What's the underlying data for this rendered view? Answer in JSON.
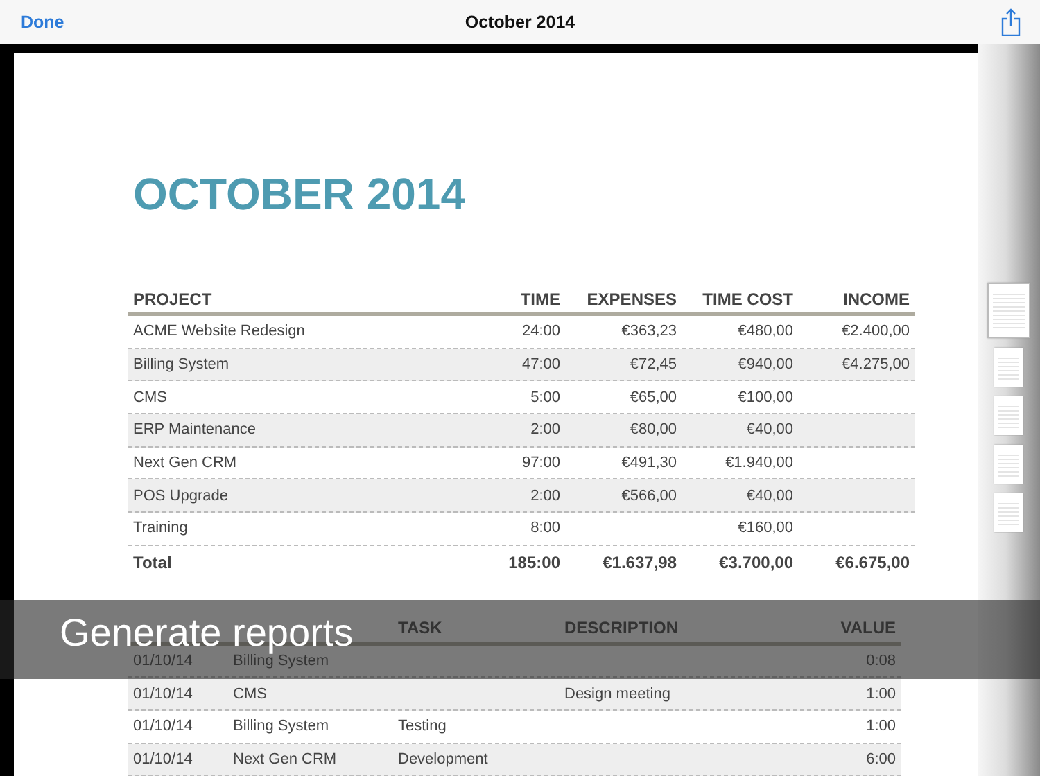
{
  "navbar": {
    "done": "Done",
    "title": "October 2014"
  },
  "report": {
    "title": "OCTOBER 2014",
    "summary": {
      "columns": [
        "PROJECT",
        "TIME",
        "EXPENSES",
        "TIME COST",
        "INCOME"
      ],
      "rows": [
        [
          "ACME Website Redesign",
          "24:00",
          "€363,23",
          "€480,00",
          "€2.400,00"
        ],
        [
          "Billing System",
          "47:00",
          "€72,45",
          "€940,00",
          "€4.275,00"
        ],
        [
          "CMS",
          "5:00",
          "€65,00",
          "€100,00",
          null
        ],
        [
          "ERP Maintenance",
          "2:00",
          "€80,00",
          "€40,00",
          null
        ],
        [
          "Next Gen CRM",
          "97:00",
          "€491,30",
          "€1.940,00",
          null
        ],
        [
          "POS Upgrade",
          "2:00",
          "€566,00",
          "€40,00",
          null
        ],
        [
          "Training",
          "8:00",
          null,
          "€160,00",
          null
        ]
      ],
      "total": [
        "Total",
        "185:00",
        "€1.637,98",
        "€3.700,00",
        "€6.675,00"
      ]
    },
    "entries": {
      "columns": [
        null,
        null,
        "TASK",
        "DESCRIPTION",
        "VALUE"
      ],
      "rows": [
        [
          "01/10/14",
          "Billing System",
          null,
          null,
          "0:08"
        ],
        [
          "01/10/14",
          "CMS",
          null,
          "Design meeting",
          "1:00"
        ],
        [
          "01/10/14",
          "Billing System",
          "Testing",
          null,
          "1:00"
        ],
        [
          "01/10/14",
          "Next Gen CRM",
          "Development",
          null,
          "6:00"
        ]
      ]
    }
  },
  "thumbnails": [
    {
      "selected": true
    },
    {
      "selected": false
    },
    {
      "selected": false
    },
    {
      "selected": false
    },
    {
      "selected": false
    }
  ],
  "banner": {
    "text": "Generate reports"
  }
}
